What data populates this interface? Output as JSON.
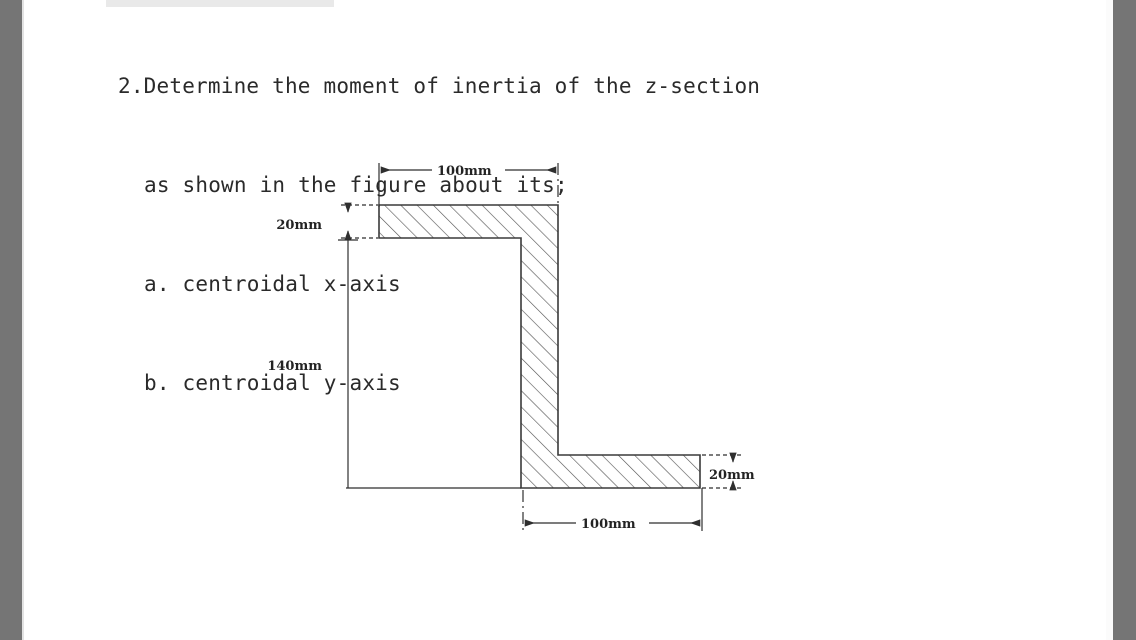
{
  "document": {
    "background_color": "#ffffff",
    "margin_color": "#757575"
  },
  "problem": {
    "number": "2.",
    "lines": [
      "2.Determine the moment of inertia of the z-section",
      "as shown in the figure about its;",
      "a. centroidal x-axis",
      "b. centroidal y-axis"
    ],
    "line1": "2.Determine the moment of inertia of the z-section",
    "line2": "as shown in the figure about its;",
    "line3": "a. centroidal x-axis",
    "line4": "b. centroidal y-axis"
  },
  "figure": {
    "title": "z-section-cross-section-diagram",
    "shape": "z-section",
    "stroke_color": "#3a3a3a",
    "hatch_color": "#555555",
    "dimensions": {
      "top_flange_width": "100mm",
      "top_flange_thickness": "20mm",
      "web_height": "140mm",
      "bottom_flange_width": "100mm",
      "bottom_flange_thickness": "20mm"
    },
    "labels": {
      "top_width": "100mm",
      "top_thickness": "20mm",
      "web_height": "140mm",
      "bottom_width": "100mm",
      "bottom_thickness": "20mm"
    }
  }
}
